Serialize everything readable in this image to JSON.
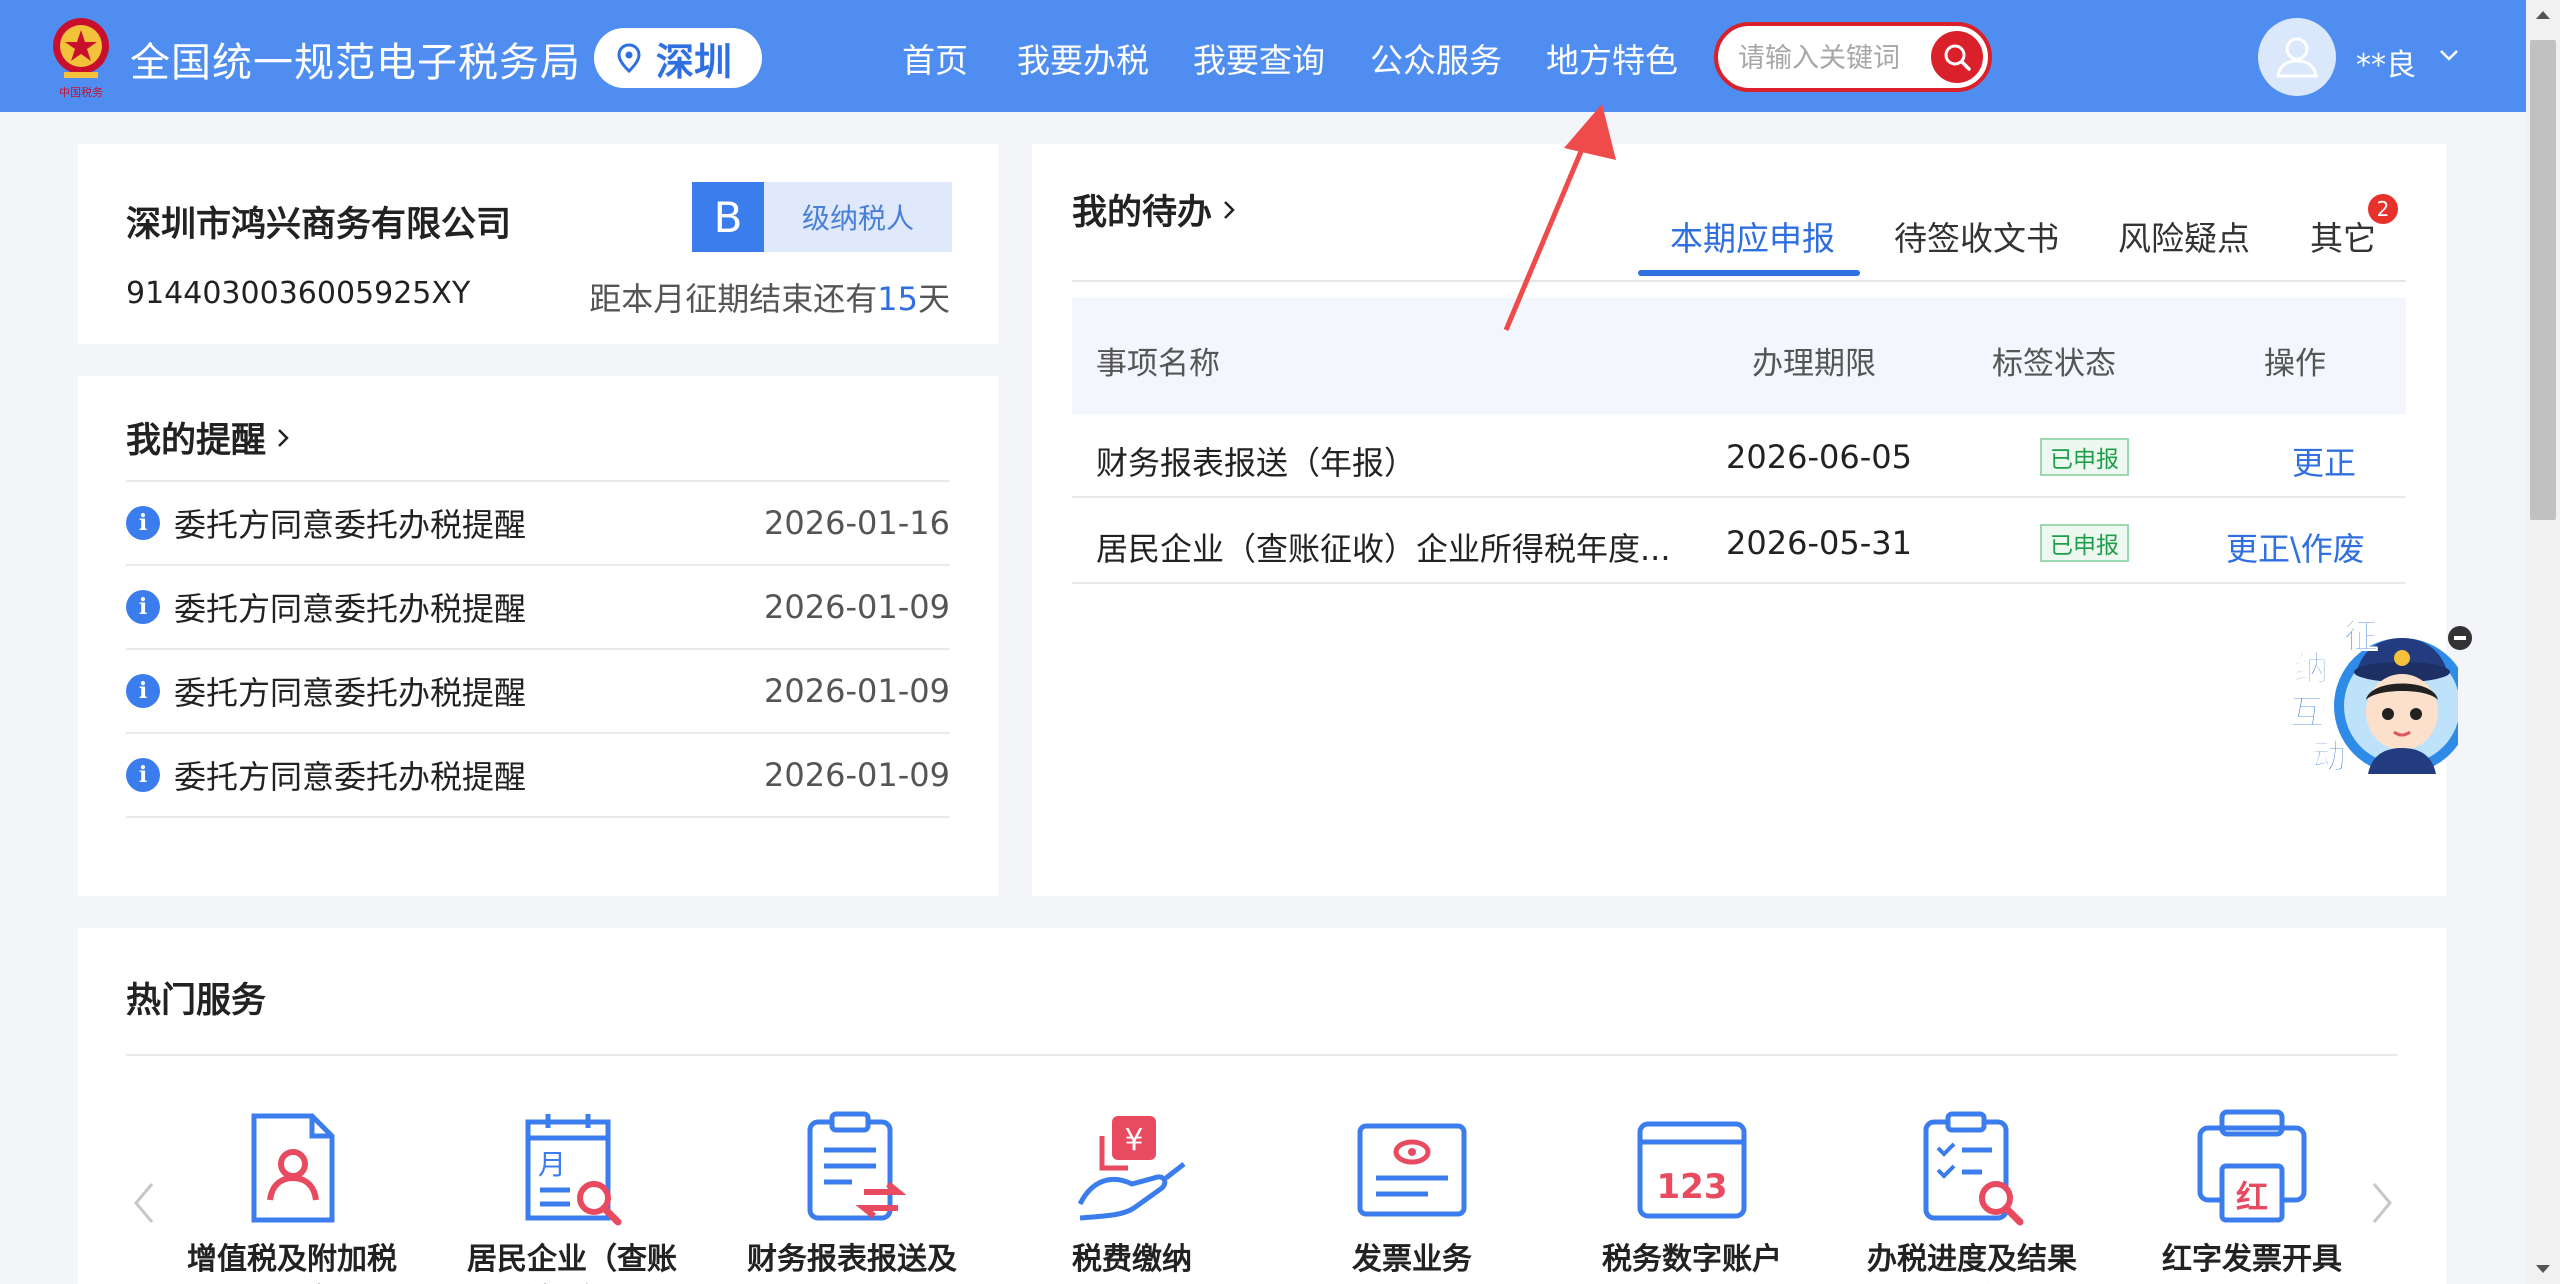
{
  "header": {
    "site_title": "全国统一规范电子税务局",
    "emblem_text": "中国税务",
    "city": "深圳",
    "nav": [
      {
        "label": "首页"
      },
      {
        "label": "我要办税"
      },
      {
        "label": "我要查询"
      },
      {
        "label": "公众服务"
      },
      {
        "label": "地方特色"
      }
    ],
    "search_placeholder": "请输入关键词",
    "user_name": "**良"
  },
  "company": {
    "name": "深圳市鸿兴商务有限公司",
    "tax_id": "9144030036005925XY",
    "level_letter": "B",
    "level_label": "级纳税人",
    "deadline_prefix": "距本月征期结束还有",
    "deadline_days": "15",
    "deadline_suffix": "天"
  },
  "reminders": {
    "title": "我的提醒",
    "items": [
      {
        "text": "委托方同意委托办税提醒",
        "date": "2026-01-16"
      },
      {
        "text": "委托方同意委托办税提醒",
        "date": "2026-01-09"
      },
      {
        "text": "委托方同意委托办税提醒",
        "date": "2026-01-09"
      },
      {
        "text": "委托方同意委托办税提醒",
        "date": "2026-01-09"
      }
    ]
  },
  "todo": {
    "title": "我的待办",
    "tabs": [
      {
        "label": "本期应申报"
      },
      {
        "label": "待签收文书"
      },
      {
        "label": "风险疑点"
      },
      {
        "label": "其它"
      }
    ],
    "other_badge": "2",
    "columns": [
      "事项名称",
      "办理期限",
      "标签状态",
      "操作"
    ],
    "rows": [
      {
        "name": "财务报表报送（年报）",
        "deadline": "2026-06-05",
        "status": "已申报",
        "action": "更正"
      },
      {
        "name": "居民企业（查账征收）企业所得税年度...",
        "deadline": "2026-05-31",
        "status": "已申报",
        "action": "更正\\作废"
      }
    ]
  },
  "hot_services": {
    "title": "热门服务",
    "items": [
      {
        "label": "增值税及附加税费申报（小规"
      },
      {
        "label": "居民企业（查账征收）企业所"
      },
      {
        "label": "财务报表报送及更正"
      },
      {
        "label": "税费缴纳"
      },
      {
        "label": "发票业务"
      },
      {
        "label": "税务数字账户"
      },
      {
        "label": "办税进度及结果查询"
      },
      {
        "label": "红字发票开具"
      }
    ]
  },
  "float_widget": {
    "chars": [
      "征",
      "纳",
      "互",
      "动"
    ]
  },
  "colors": {
    "header_blue": "#4f8ef0",
    "accent_blue": "#2f6fe0",
    "search_red": "#d9202b",
    "status_green": "#1e9e4a"
  }
}
